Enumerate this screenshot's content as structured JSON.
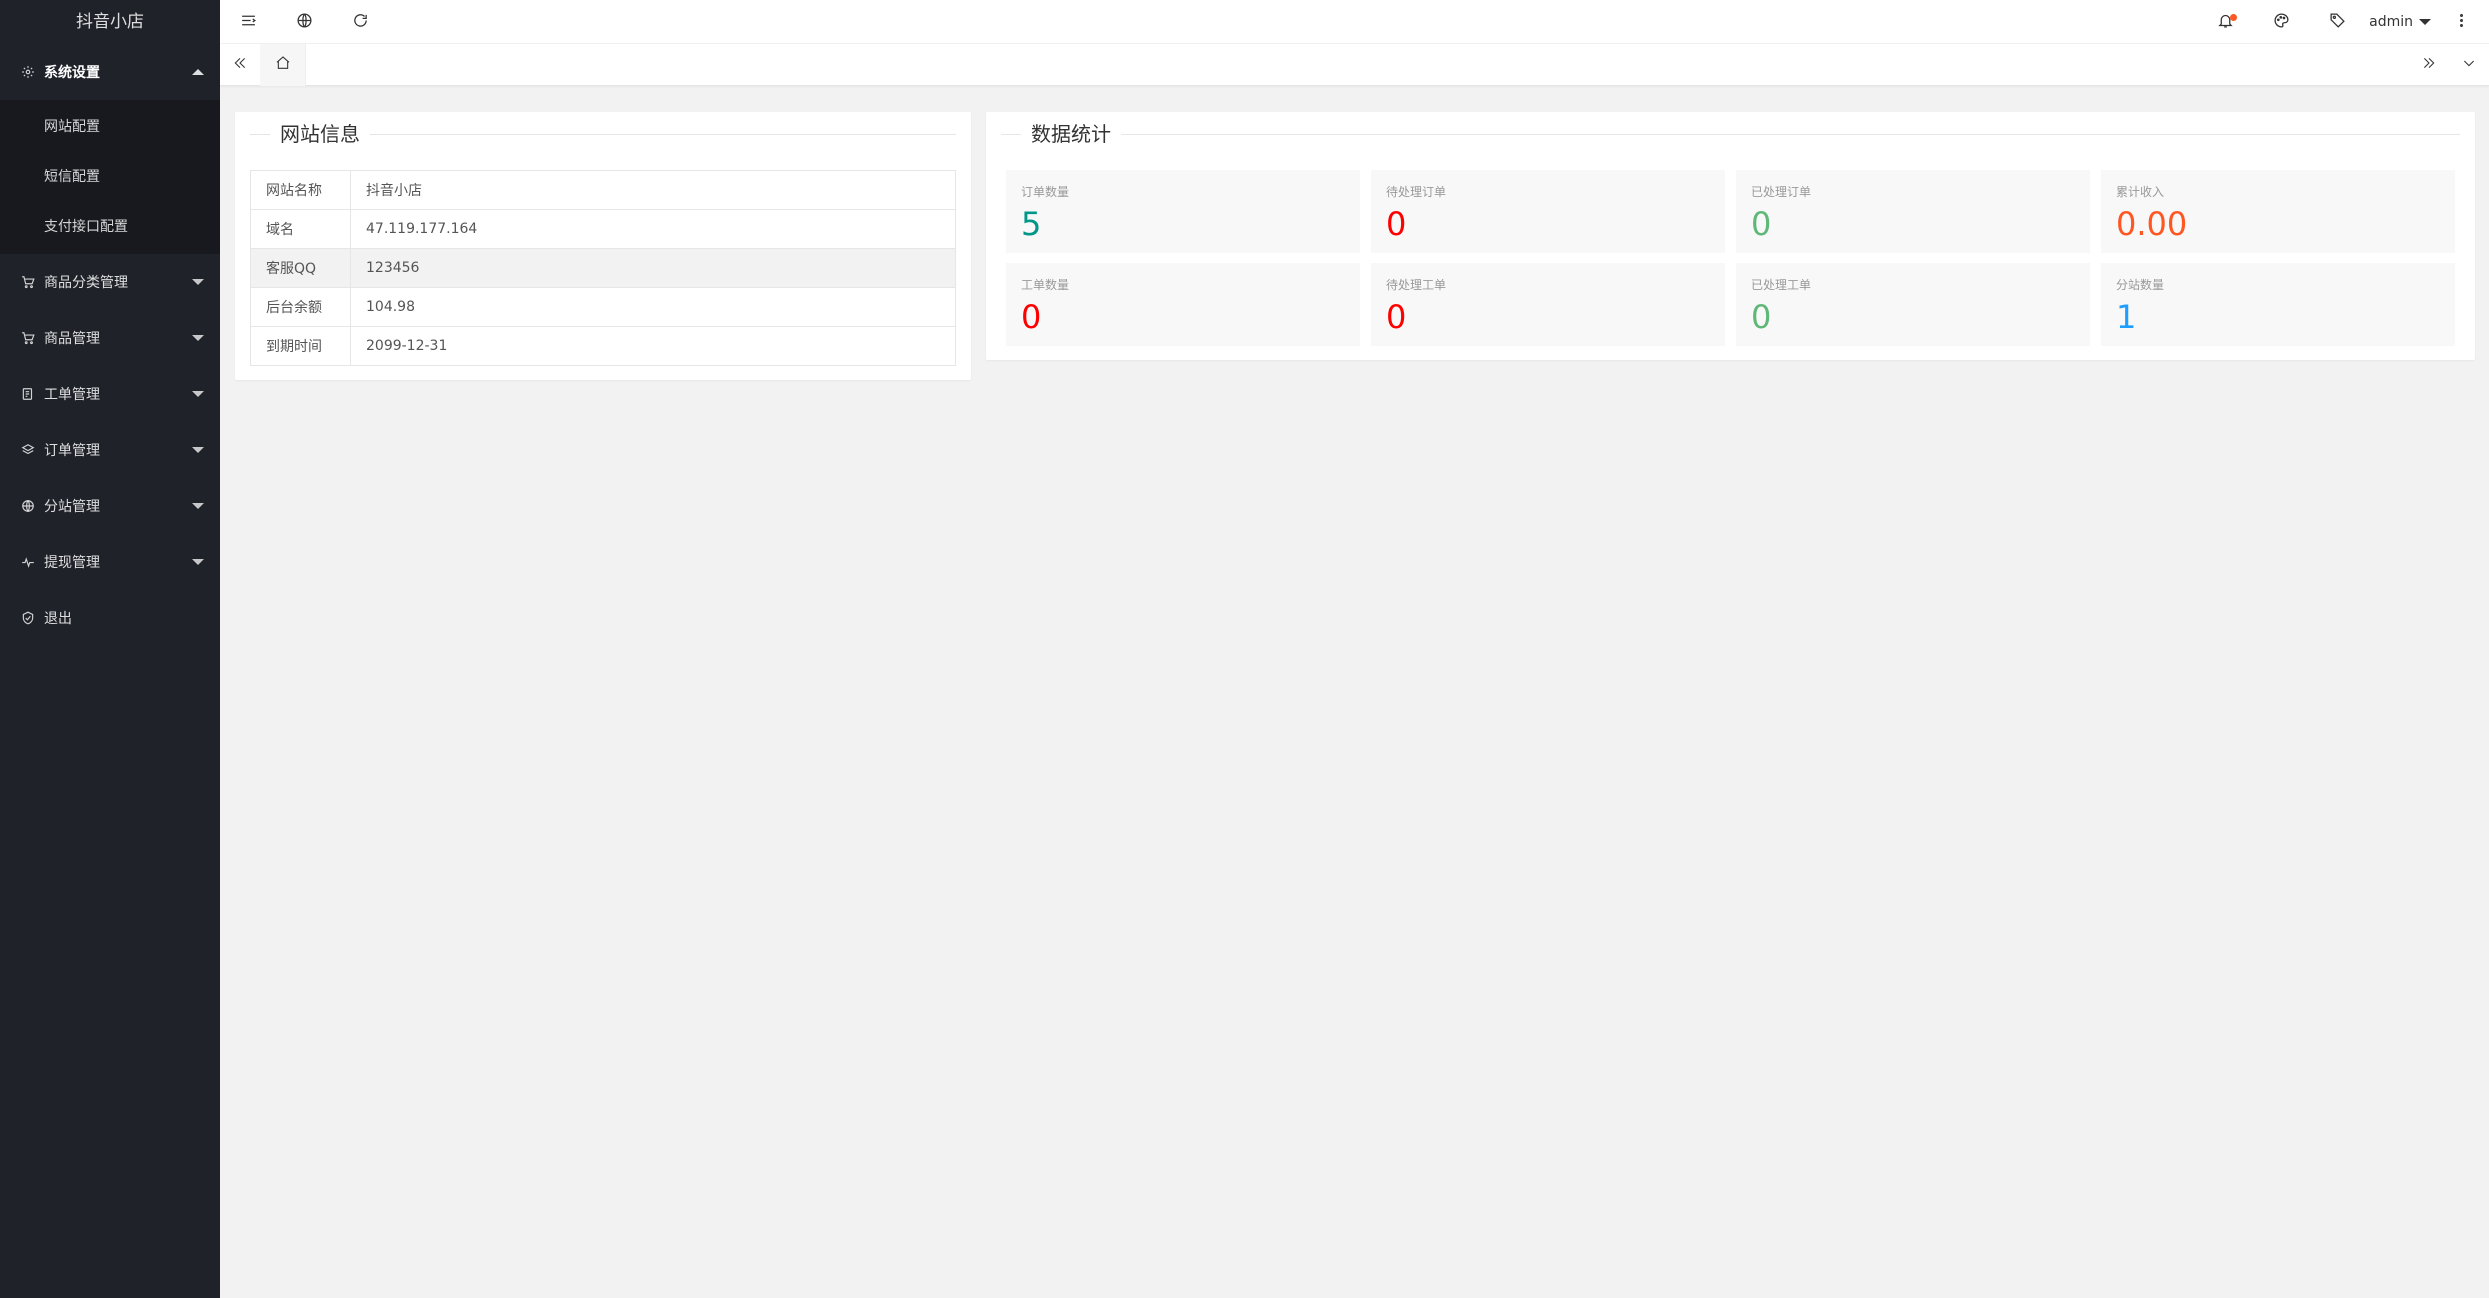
{
  "app": {
    "logo_text": "抖音小店"
  },
  "sidebar": {
    "system": {
      "label": "系统设置",
      "icon": "gear-icon",
      "subitems": [
        "网站配置",
        "短信配置",
        "支付接口配置"
      ]
    },
    "items": [
      {
        "label": "商品分类管理",
        "icon": "cart-icon"
      },
      {
        "label": "商品管理",
        "icon": "cart-icon"
      },
      {
        "label": "工单管理",
        "icon": "ticket-icon"
      },
      {
        "label": "订单管理",
        "icon": "layers-icon"
      },
      {
        "label": "分站管理",
        "icon": "globe-icon"
      },
      {
        "label": "提现管理",
        "icon": "pulse-icon"
      },
      {
        "label": "退出",
        "icon": "shield-icon"
      }
    ]
  },
  "header": {
    "user_name": "admin"
  },
  "site_info": {
    "title": "网站信息",
    "rows": [
      {
        "key": "网站名称",
        "value": "抖音小店"
      },
      {
        "key": "域名",
        "value": "47.119.177.164"
      },
      {
        "key": "客服QQ",
        "value": "123456"
      },
      {
        "key": "后台余额",
        "value": "104.98"
      },
      {
        "key": "到期时间",
        "value": "2099-12-31"
      }
    ]
  },
  "stats": {
    "title": "数据统计",
    "items": [
      {
        "label": "订单数量",
        "value": "5",
        "color": "#009688"
      },
      {
        "label": "待处理订单",
        "value": "0",
        "color": "#ff0000"
      },
      {
        "label": "已处理订单",
        "value": "0",
        "color": "#5fb878"
      },
      {
        "label": "累计收入",
        "value": "0.00",
        "color": "#ff5722"
      },
      {
        "label": "工单数量",
        "value": "0",
        "color": "#ff0000"
      },
      {
        "label": "待处理工单",
        "value": "0",
        "color": "#ff0000"
      },
      {
        "label": "已处理工单",
        "value": "0",
        "color": "#5fb878"
      },
      {
        "label": "分站数量",
        "value": "1",
        "color": "#1e9fff"
      }
    ]
  }
}
